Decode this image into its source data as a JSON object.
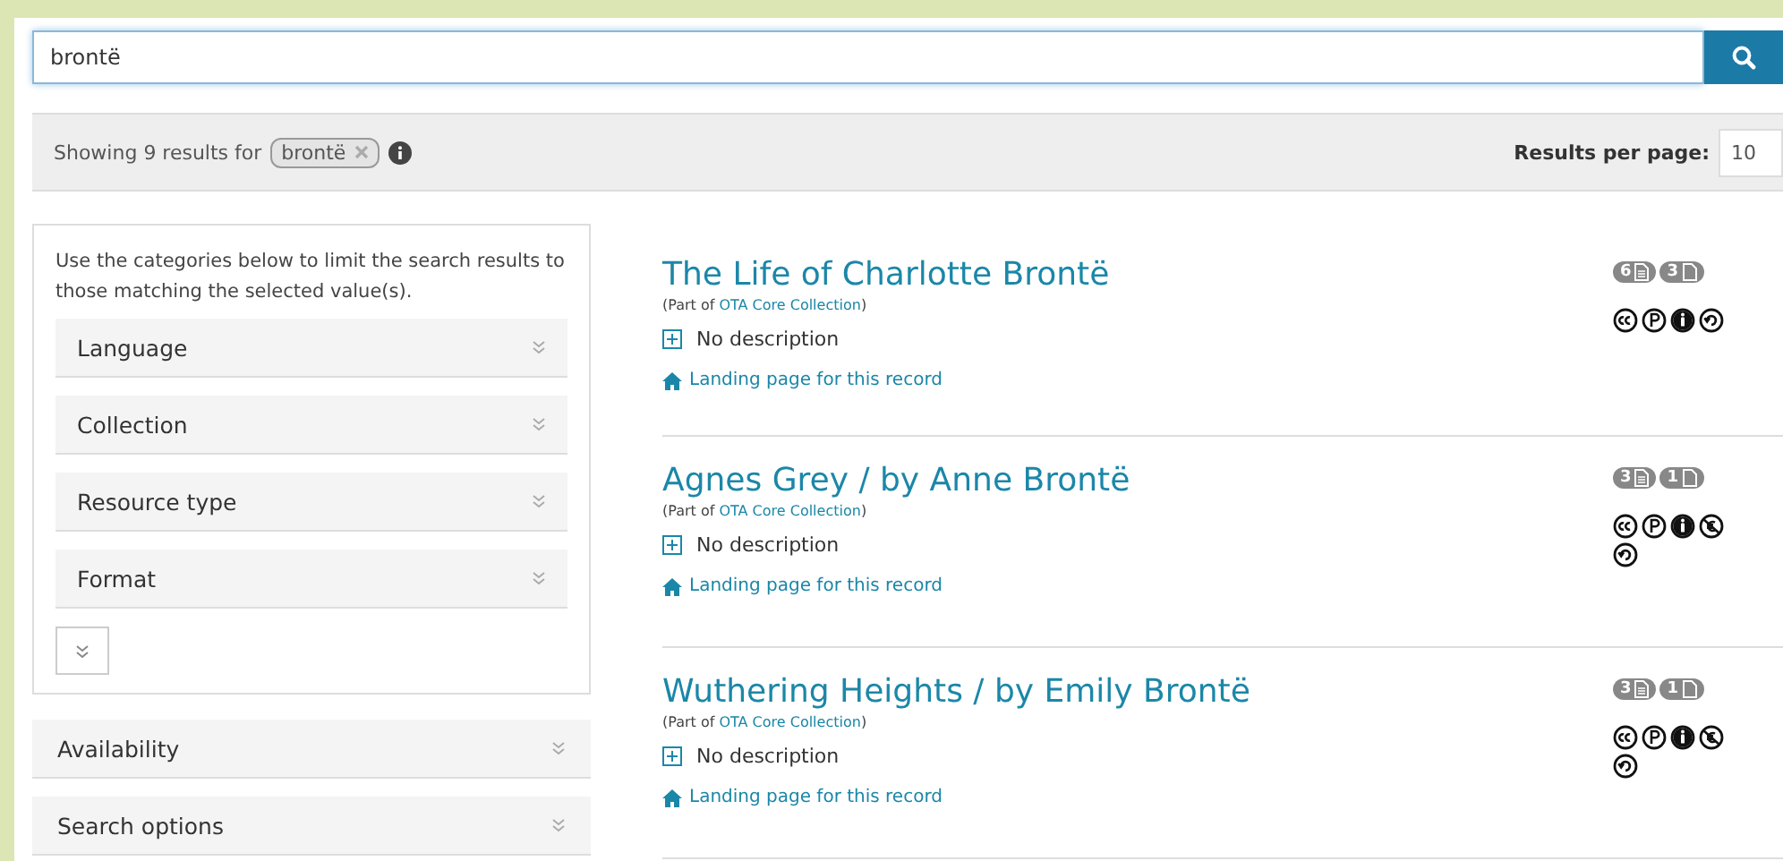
{
  "search": {
    "value": "brontë"
  },
  "summary": {
    "text": "Showing 9 results for",
    "query_tag": "brontë",
    "per_page_label": "Results per page:",
    "per_page_value": "10"
  },
  "sidebar": {
    "intro": "Use the categories below to limit the search results to those matching the selected value(s).",
    "categories": [
      "Language",
      "Collection",
      "Resource type",
      "Format"
    ],
    "panels": [
      "Availability",
      "Search options"
    ]
  },
  "results": [
    {
      "title": "The Life of Charlotte Brontë",
      "part_of_prefix": "(Part of",
      "collection": "OTA Core Collection",
      "part_of_suffix": ")",
      "description": "No description",
      "landing": "Landing page for this record",
      "badges": [
        {
          "count": "6",
          "kind": "text"
        },
        {
          "count": "3",
          "kind": "file"
        }
      ],
      "licenses": [
        {
          "kind": "cc"
        },
        {
          "kind": "pd"
        },
        {
          "kind": "by"
        },
        {
          "kind": "sa"
        }
      ]
    },
    {
      "title": "Agnes Grey / by Anne Brontë",
      "part_of_prefix": "(Part of",
      "collection": "OTA Core Collection",
      "part_of_suffix": ")",
      "description": "No description",
      "landing": "Landing page for this record",
      "badges": [
        {
          "count": "3",
          "kind": "text"
        },
        {
          "count": "1",
          "kind": "file"
        }
      ],
      "licenses": [
        {
          "kind": "cc"
        },
        {
          "kind": "pd"
        },
        {
          "kind": "by"
        },
        {
          "kind": "nc"
        },
        {
          "kind": "sa"
        }
      ]
    },
    {
      "title": "Wuthering Heights / by Emily Brontë",
      "part_of_prefix": "(Part of",
      "collection": "OTA Core Collection",
      "part_of_suffix": ")",
      "description": "No description",
      "landing": "Landing page for this record",
      "badges": [
        {
          "count": "3",
          "kind": "text"
        },
        {
          "count": "1",
          "kind": "file"
        }
      ],
      "licenses": [
        {
          "kind": "cc"
        },
        {
          "kind": "pd"
        },
        {
          "kind": "by"
        },
        {
          "kind": "nc"
        },
        {
          "kind": "sa"
        }
      ]
    }
  ]
}
